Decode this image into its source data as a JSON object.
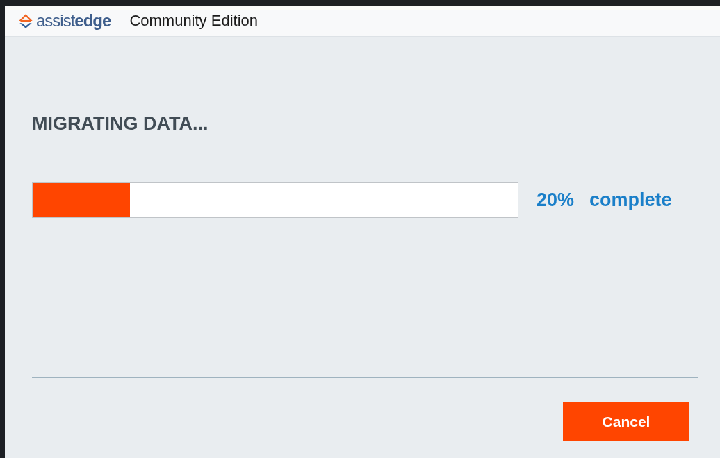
{
  "header": {
    "logo": "assist**edge**",
    "edition": "Community Edition"
  },
  "title": "MIGRATING DATA...",
  "progress": {
    "level": 0.2,
    "percent": "20%",
    "label": "complete"
  },
  "buttons": [
    {
      "label": "Cancel"
    }
  ]
}
